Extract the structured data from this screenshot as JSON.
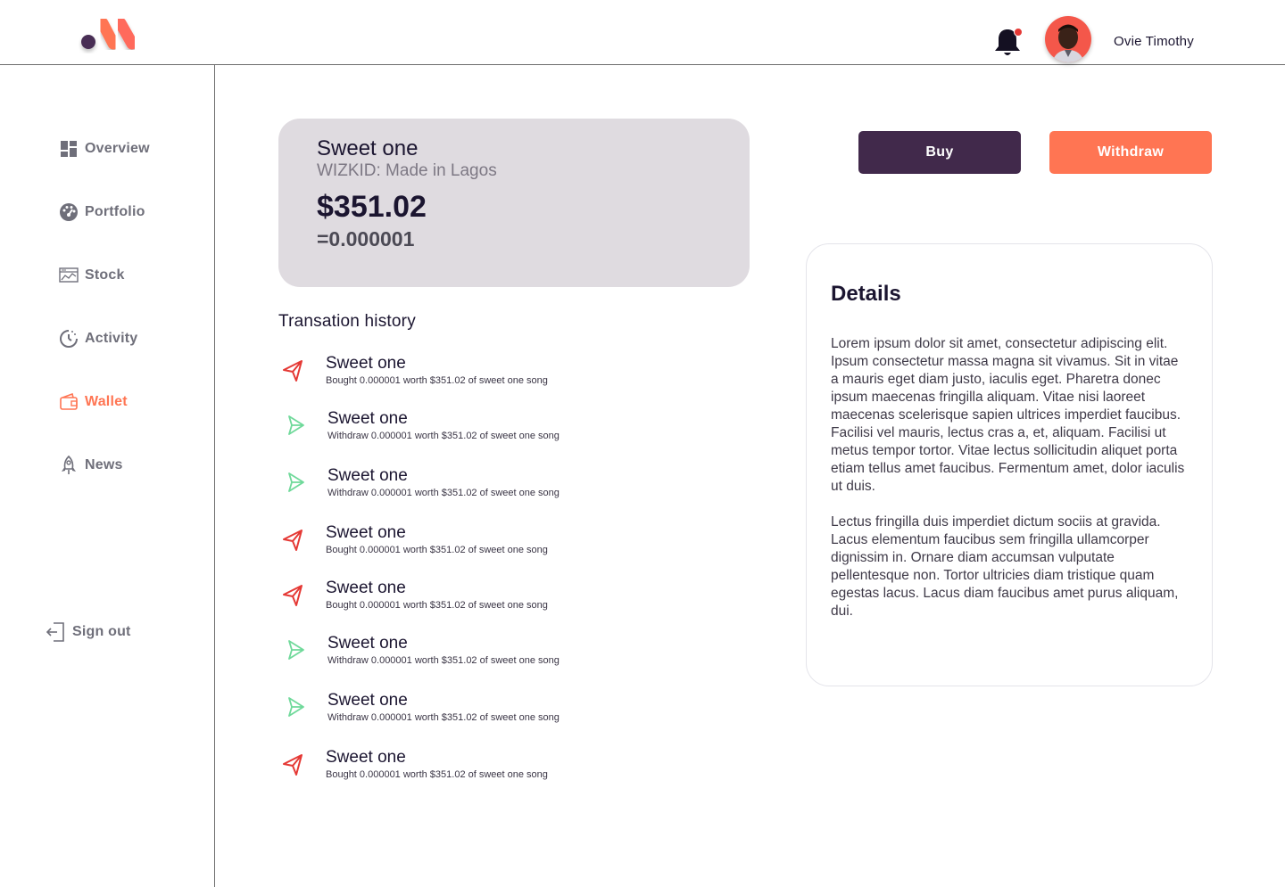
{
  "header": {
    "username": "Ovie Timothy",
    "notification_badge_color": "#e53935"
  },
  "sidebar": {
    "items": [
      {
        "label": "Overview",
        "icon": "grid-icon",
        "active": false
      },
      {
        "label": "Portfolio",
        "icon": "gauge-icon",
        "active": false
      },
      {
        "label": "Stock",
        "icon": "chart-icon",
        "active": false
      },
      {
        "label": "Activity",
        "icon": "clock-icon",
        "active": false
      },
      {
        "label": "Wallet",
        "icon": "wallet-icon",
        "active": true
      },
      {
        "label": "News",
        "icon": "rocket-icon",
        "active": false
      }
    ],
    "signout_label": "Sign out"
  },
  "card": {
    "title": "Sweet one",
    "subtitle": "WIZKID: Made in Lagos",
    "price": "$351.02",
    "equivalent": "=0.000001"
  },
  "history": {
    "title": "Transation history",
    "items": [
      {
        "type": "bought",
        "name": "Sweet one",
        "desc": "Bought 0.000001 worth $351.02 of sweet one song"
      },
      {
        "type": "withdraw",
        "name": "Sweet one",
        "desc": "Withdraw 0.000001 worth $351.02 of sweet one song"
      },
      {
        "type": "withdraw",
        "name": "Sweet one",
        "desc": "Withdraw 0.000001 worth $351.02 of sweet one song"
      },
      {
        "type": "bought",
        "name": "Sweet one",
        "desc": "Bought 0.000001 worth $351.02 of sweet one song"
      },
      {
        "type": "bought",
        "name": "Sweet one",
        "desc": "Bought 0.000001 worth $351.02 of sweet one song"
      },
      {
        "type": "withdraw",
        "name": "Sweet one",
        "desc": "Withdraw 0.000001 worth $351.02 of sweet one song"
      },
      {
        "type": "withdraw",
        "name": "Sweet one",
        "desc": "Withdraw 0.000001 worth $351.02 of sweet one song"
      },
      {
        "type": "bought",
        "name": "Sweet one",
        "desc": "Bought 0.000001 worth $351.02 of sweet one song"
      }
    ]
  },
  "actions": {
    "buy_label": "Buy",
    "withdraw_label": "Withdraw"
  },
  "details": {
    "title": "Details",
    "paragraph1": "Lorem ipsum dolor sit amet, consectetur adipiscing elit. Ipsum consectetur massa magna sit vivamus. Sit in vitae a mauris eget diam justo, iaculis eget. Pharetra donec ipsum maecenas fringilla aliquam. Vitae nisi laoreet maecenas scelerisque sapien ultrices imperdiet faucibus. Facilisi vel mauris, lectus cras a, et, aliquam. Facilisi ut metus tempor tortor. Vitae lectus sollicitudin aliquet porta etiam tellus amet faucibus. Fermentum amet, dolor iaculis ut duis.",
    "paragraph2": "Lectus fringilla duis imperdiet dictum sociis at gravida. Lacus elementum faucibus sem fringilla ullamcorper dignissim in. Ornare diam accumsan vulputate pellentesque non. Tortor ultricies diam tristique quam egestas lacus. Lacus diam faucibus amet purus aliquam, dui."
  },
  "colors": {
    "accent": "#ff7553",
    "primary": "#41294b",
    "card_bg": "#dfdbe0",
    "bought_icon": "#e53935",
    "withdraw_icon": "#6fd99a"
  }
}
